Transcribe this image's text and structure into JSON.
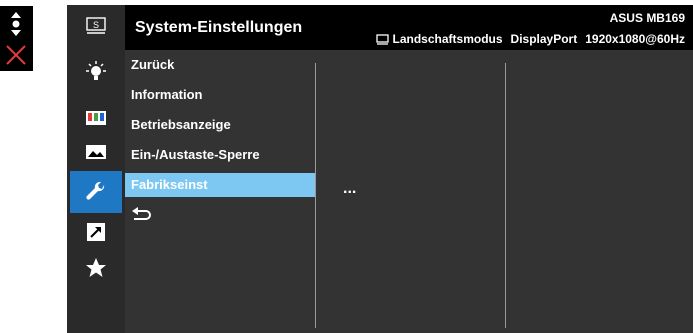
{
  "osd": {
    "title": "System-Einstellungen",
    "model": "ASUS MB169",
    "orientation": "Landschaftsmodus",
    "input": "DisplayPort",
    "resolution": "1920x1080@60Hz"
  },
  "icons": [
    {
      "name": "splendid-icon",
      "glyph": "S"
    },
    {
      "name": "blue-light-filter-icon"
    },
    {
      "name": "color-icon"
    },
    {
      "name": "image-icon"
    },
    {
      "name": "system-setup-icon",
      "active": true
    },
    {
      "name": "shortcut-icon"
    },
    {
      "name": "myfavorite-icon"
    }
  ],
  "menu": {
    "items": [
      "Zurück",
      "Information",
      "Betriebsanzeige",
      "Ein-/Austaste-Sperre",
      "Fabrikseinst"
    ],
    "selected_index": 4
  },
  "submenu": {
    "placeholder": "..."
  },
  "colors": {
    "accent": "#1f78c4",
    "highlight": "#7dc7f3",
    "panel": "#333333",
    "iconbar": "#2a2a2a"
  }
}
